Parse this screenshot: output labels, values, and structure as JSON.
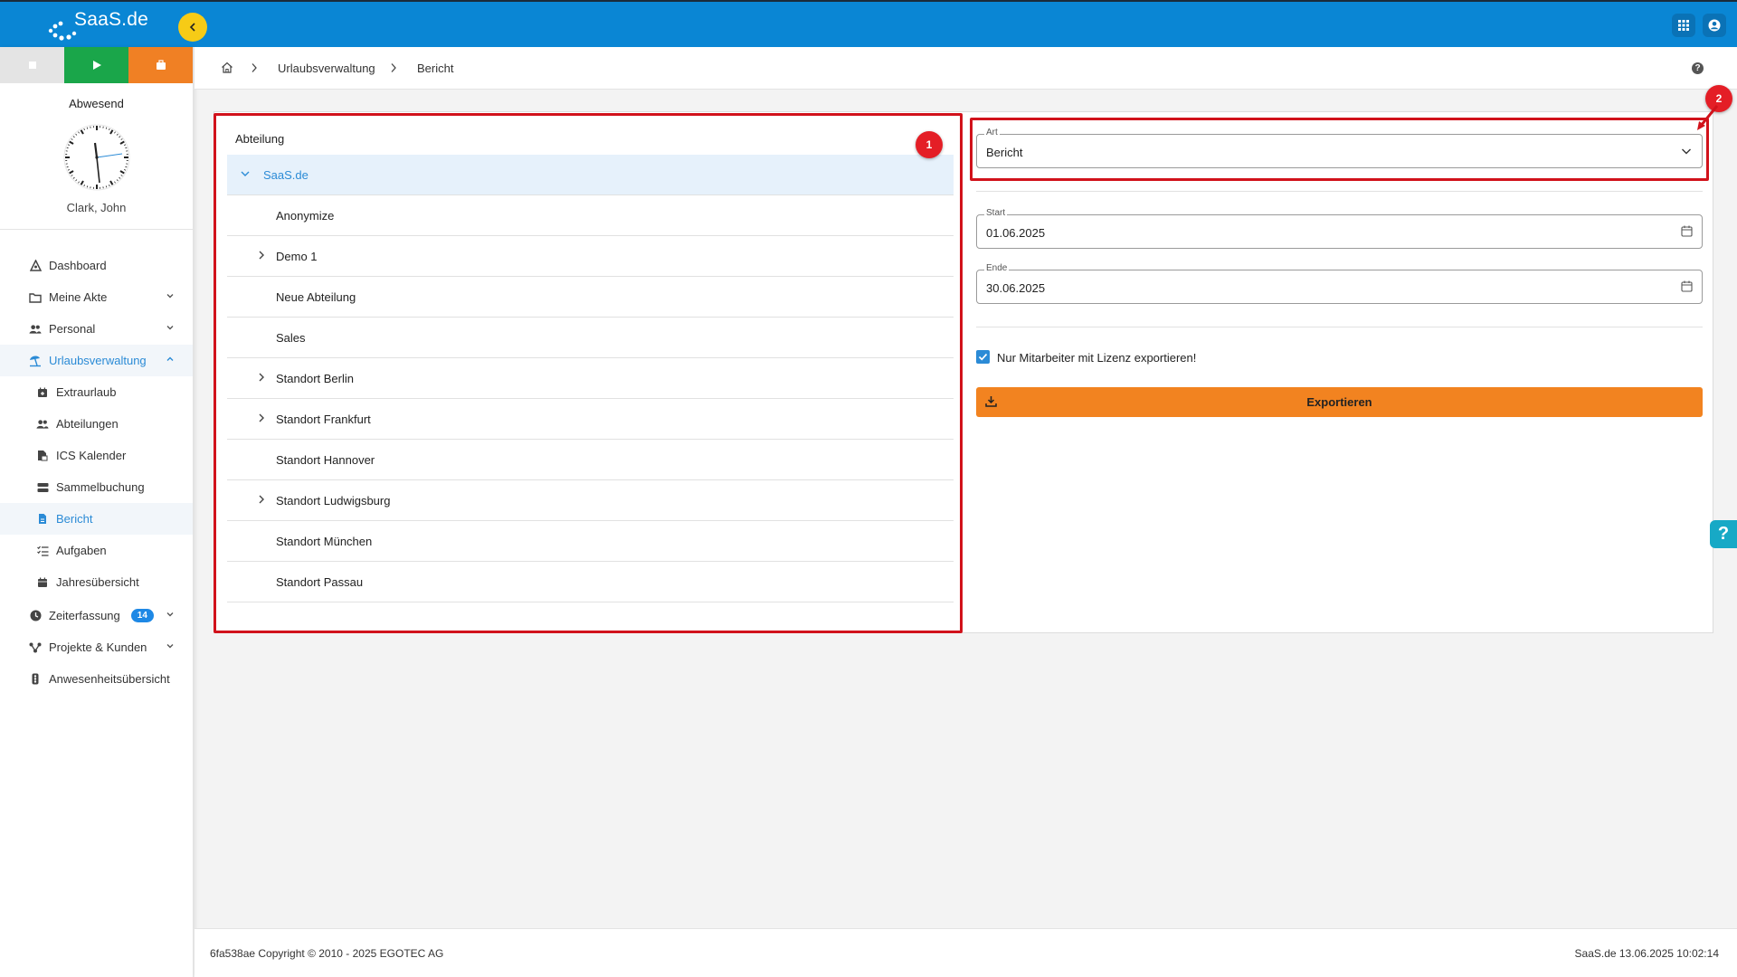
{
  "app": {
    "logo_text": "SaaS.de"
  },
  "sidebar": {
    "presence": "Abwesend",
    "user_name": "Clark, John",
    "nav": [
      {
        "label": "Dashboard"
      },
      {
        "label": "Meine Akte"
      },
      {
        "label": "Personal"
      },
      {
        "label": "Urlaubsverwaltung"
      },
      {
        "label": "Extraurlaub"
      },
      {
        "label": "Abteilungen"
      },
      {
        "label": "ICS Kalender"
      },
      {
        "label": "Sammelbuchung"
      },
      {
        "label": "Bericht"
      },
      {
        "label": "Aufgaben"
      },
      {
        "label": "Jahresübersicht"
      },
      {
        "label": "Zeiterfassung",
        "badge": "14"
      },
      {
        "label": "Projekte & Kunden"
      },
      {
        "label": "Anwesenheitsübersicht"
      }
    ]
  },
  "breadcrumb": {
    "items": [
      "Urlaubsverwaltung",
      "Bericht"
    ]
  },
  "tree": {
    "title": "Abteilung",
    "root": "SaaS.de",
    "rows": [
      "Anonymize",
      "Demo 1",
      "Neue Abteilung",
      "Sales",
      "Standort Berlin",
      "Standort Frankfurt",
      "Standort Hannover",
      "Standort Ludwigsburg",
      "Standort München",
      "Standort Passau"
    ]
  },
  "form": {
    "art_label": "Art",
    "art_value": "Bericht",
    "start_label": "Start",
    "start_value": "01.06.2025",
    "end_label": "Ende",
    "end_value": "30.06.2025",
    "license_checkbox_label": "Nur Mitarbeiter mit Lizenz exportieren!",
    "license_checked": true,
    "export_label": "Exportieren"
  },
  "markers": {
    "m1": "1",
    "m2": "2"
  },
  "footer": {
    "left": "6fa538ae Copyright © 2010 - 2025 EGOTEC AG",
    "right": "SaaS.de  13.06.2025 10:02:14"
  },
  "colors": {
    "topbar": "#0a86d4",
    "accent": "#2b8bd6",
    "export": "#f28320",
    "highlight_box": "#d1121b"
  }
}
